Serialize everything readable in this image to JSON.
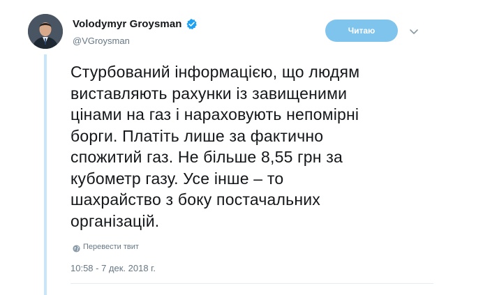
{
  "author": {
    "display_name": "Volodymyr Groysman",
    "handle": "@VGroysman",
    "avatar_icon": "person-avatar-icon",
    "verified_icon": "verified-badge-icon"
  },
  "actions": {
    "follow_label": "Читаю",
    "menu_icon": "chevron-down-icon"
  },
  "tweet": {
    "lines": [
      "Стурбований інформацією, що людям",
      "виставляють рахунки із завищеними",
      "цінами на газ і нараховують непомірні",
      "борги. Платіть лише за фактично",
      "спожитий газ. Не більше 8,55 грн за",
      "кубометр газу. Усе інше – то",
      "шахрайство з боку постачальних",
      "організацій."
    ],
    "translate_label": "Перевести твит",
    "translate_icon": "globe-icon",
    "timestamp": "10:58 - 7 дек. 2018 г."
  },
  "colors": {
    "verified": "#1da1f2",
    "follow_button": "#7fc4ed",
    "thread_line": "#c8e6fa",
    "secondary_text": "#657786"
  }
}
